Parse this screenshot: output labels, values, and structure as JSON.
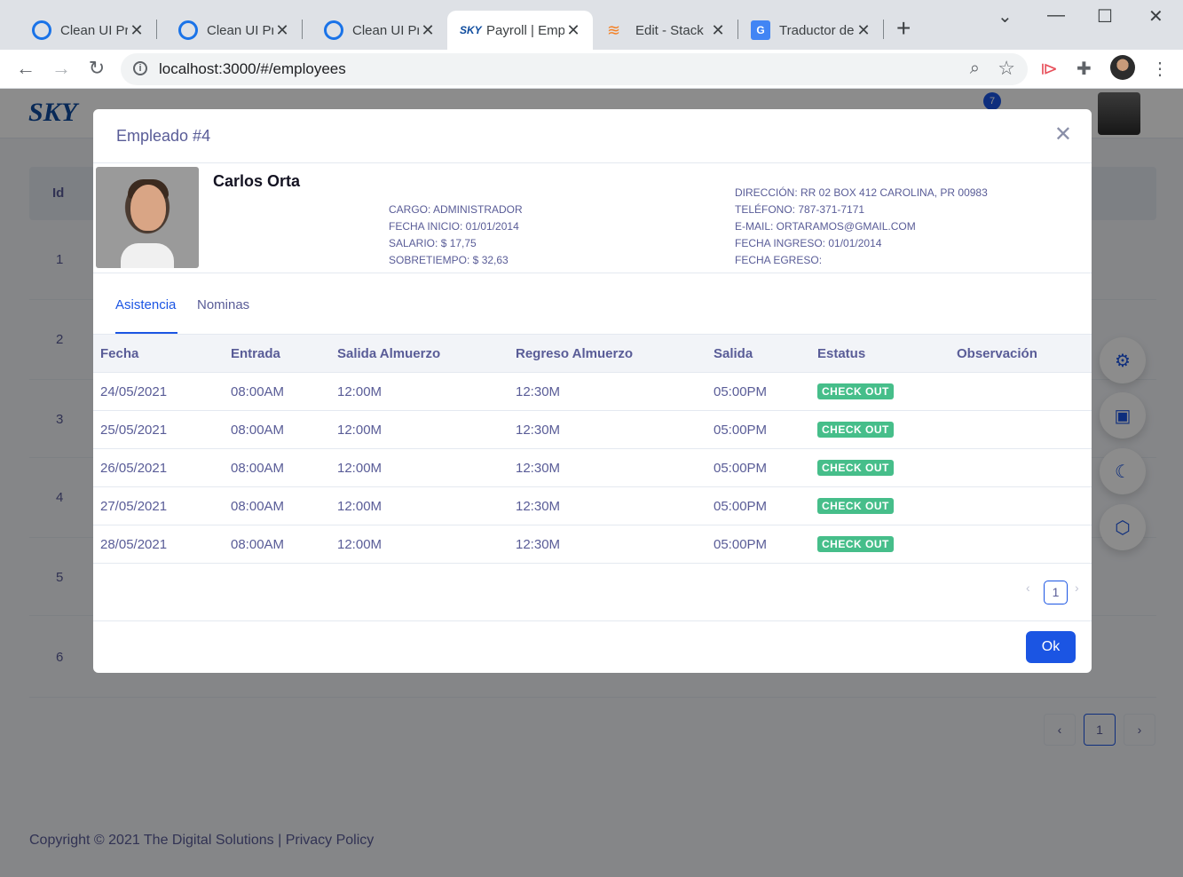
{
  "browser": {
    "tabs": [
      {
        "title": "Clean UI Pro",
        "icon": "ring-icon"
      },
      {
        "title": "Clean UI Pro",
        "icon": "ring-icon"
      },
      {
        "title": "Clean UI Pro",
        "icon": "ring-icon"
      },
      {
        "title": "Payroll | Emp",
        "icon": "sky-icon",
        "active": true
      },
      {
        "title": "Edit - Stack",
        "icon": "stackoverflow-icon"
      },
      {
        "title": "Traductor de",
        "icon": "translate-icon"
      }
    ],
    "url": "localhost:3000/#/employees"
  },
  "app": {
    "logo": "SKY",
    "notification_count": "7",
    "table_header_id": "Id",
    "row_ids": [
      "1",
      "2",
      "3",
      "4",
      "5",
      "6"
    ],
    "pager_page": "1",
    "footer": "Copyright © 2021 The Digital Solutions | Privacy Policy"
  },
  "modal": {
    "title": "Empleado #4",
    "employee": {
      "name": "Carlos Orta",
      "cargo": "CARGO: ADMINISTRADOR",
      "fecha_inicio": "FECHA INICIO: 01/01/2014",
      "salario": "SALARIO: $ 17,75",
      "sobretiempo": "SOBRETIEMPO: $ 32,63",
      "direccion": "DIRECCIÓN: RR 02 BOX 412 CAROLINA, PR 00983",
      "telefono": "TELÉFONO: 787-371-7171",
      "email": "E-MAIL: ORTARAMOS@GMAIL.COM",
      "fecha_ingreso": "FECHA INGRESO: 01/01/2014",
      "fecha_egreso": "FECHA EGRESO:"
    },
    "tabs": [
      "Asistencia",
      "Nominas"
    ],
    "table": {
      "columns": [
        "Fecha",
        "Entrada",
        "Salida Almuerzo",
        "Regreso Almuerzo",
        "Salida",
        "Estatus",
        "Observación"
      ],
      "rows": [
        {
          "fecha": "24/05/2021",
          "entrada": "08:00AM",
          "salida_almuerzo": "12:00M",
          "regreso_almuerzo": "12:30M",
          "salida": "05:00PM",
          "estatus": "CHECK OUT",
          "observacion": ""
        },
        {
          "fecha": "25/05/2021",
          "entrada": "08:00AM",
          "salida_almuerzo": "12:00M",
          "regreso_almuerzo": "12:30M",
          "salida": "05:00PM",
          "estatus": "CHECK OUT",
          "observacion": ""
        },
        {
          "fecha": "26/05/2021",
          "entrada": "08:00AM",
          "salida_almuerzo": "12:00M",
          "regreso_almuerzo": "12:30M",
          "salida": "05:00PM",
          "estatus": "CHECK OUT",
          "observacion": ""
        },
        {
          "fecha": "27/05/2021",
          "entrada": "08:00AM",
          "salida_almuerzo": "12:00M",
          "regreso_almuerzo": "12:30M",
          "salida": "05:00PM",
          "estatus": "CHECK OUT",
          "observacion": ""
        },
        {
          "fecha": "28/05/2021",
          "entrada": "08:00AM",
          "salida_almuerzo": "12:00M",
          "regreso_almuerzo": "12:30M",
          "salida": "05:00PM",
          "estatus": "CHECK OUT",
          "observacion": ""
        }
      ]
    },
    "pagination_page": "1",
    "ok_label": "Ok"
  },
  "colors": {
    "primary": "#1b55e3",
    "status_green": "#46be8a",
    "text": "#595c97"
  }
}
